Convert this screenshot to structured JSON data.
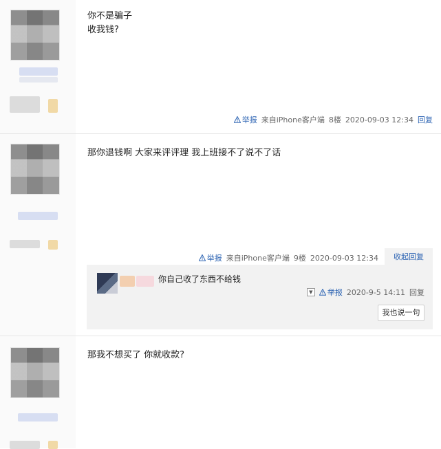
{
  "posts": [
    {
      "lines": [
        "你不是骗子",
        "收我钱?"
      ],
      "report_label": "举报",
      "source": "来自iPhone客户端",
      "floor": "8楼",
      "time": "2020-09-03 12:34",
      "reply_label": "回复"
    },
    {
      "lines": [
        "那你退钱啊 大家来评评理 我上班接不了说不了话"
      ],
      "report_label": "举报",
      "source": "来自iPhone客户端",
      "floor": "9楼",
      "time": "2020-09-03 12:34",
      "collapse_label": "收起回复",
      "sub_reply": {
        "text": "你自己收了东西不给钱",
        "report_label": "举报",
        "time": "2020-9-5 14:11",
        "reply_label": "回复",
        "say_button": "我也说一句"
      }
    },
    {
      "lines": [
        "那我不想买了 你就收款?"
      ]
    }
  ],
  "colors": {
    "link": "#2d64b3",
    "divider": "#e5e5e5",
    "author_bg": "#fafafa",
    "reply_bg": "#f2f2f2"
  },
  "icons": {
    "report": "warning-triangle-icon",
    "dropdown": "chevron-down-icon"
  }
}
